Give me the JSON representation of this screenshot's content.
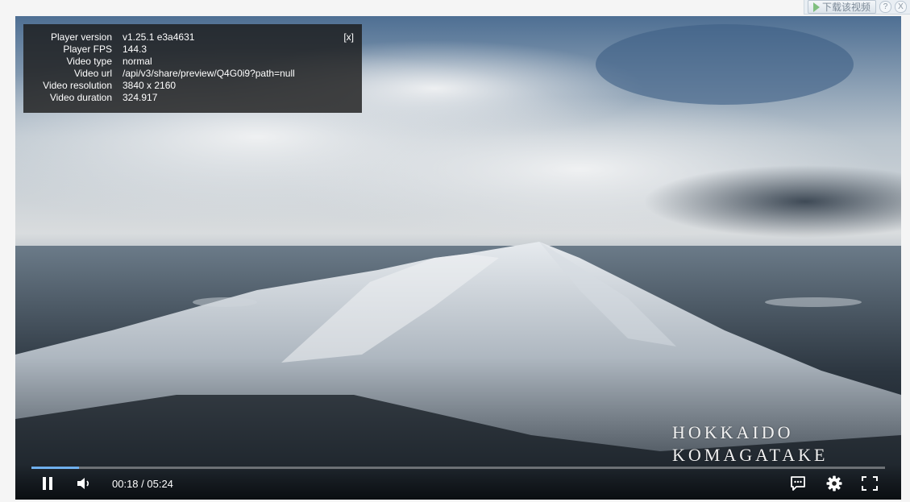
{
  "download_widget": {
    "label": "下载该视频",
    "help": "?",
    "close": "X"
  },
  "stats": {
    "close_label": "[x]",
    "rows": [
      {
        "key": "Player version",
        "value": "v1.25.1 e3a4631"
      },
      {
        "key": "Player FPS",
        "value": "144.3"
      },
      {
        "key": "Video type",
        "value": "normal"
      },
      {
        "key": "Video url",
        "value": "/api/v3/share/preview/Q4G0i9?path=null"
      },
      {
        "key": "Video resolution",
        "value": "3840 x 2160"
      },
      {
        "key": "Video duration",
        "value": "324.917"
      }
    ]
  },
  "watermark": {
    "line1": "HOKKAIDO",
    "line2": "KOMAGATAKE"
  },
  "player": {
    "time_display": "00:18 / 05:24",
    "progress_fraction": 0.0554,
    "accent": "#6fb0ee",
    "icons": [
      "pause-icon",
      "volume-icon",
      "subtitles-icon",
      "settings-icon",
      "fullscreen-icon"
    ]
  }
}
